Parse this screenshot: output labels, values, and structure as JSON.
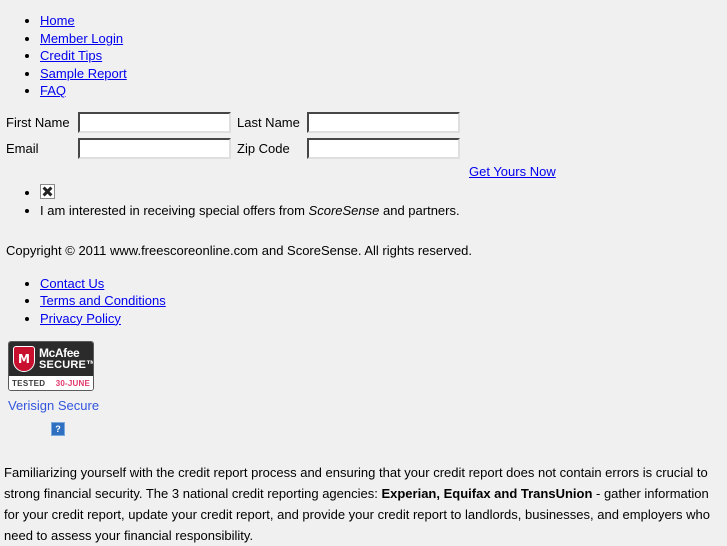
{
  "colors": {
    "page_background": "#f0f0f0",
    "link": "#0000ee",
    "verisign_link": "#3355dd",
    "mcafee_dark": "#2b2b2b",
    "mcafee_shield_red": "#c8102e",
    "mcafee_date_red": "#e0386a"
  },
  "top_nav": {
    "items": [
      {
        "label": "Home"
      },
      {
        "label": "Member Login"
      },
      {
        "label": "Credit Tips"
      },
      {
        "label": "Sample Report"
      },
      {
        "label": "FAQ"
      }
    ]
  },
  "signup_form": {
    "fields": [
      {
        "label": "First Name",
        "value": "",
        "placeholder": ""
      },
      {
        "label": "Last Name",
        "value": "",
        "placeholder": ""
      },
      {
        "label": "Email",
        "value": "",
        "placeholder": ""
      },
      {
        "label": "Zip Code",
        "value": "",
        "placeholder": ""
      }
    ],
    "submit_label": "Get Yours Now"
  },
  "offers": {
    "broken_image_alt": "broken-image",
    "consent_text_before": "I am interested in receiving special offers from ",
    "brand": "ScoreSense",
    "consent_text_after": " and partners."
  },
  "copyright": {
    "text": "Copyright © 2011 www.freescoreonline.com and ScoreSense. All rights reserved."
  },
  "footer_nav": {
    "items": [
      {
        "label": "Contact Us"
      },
      {
        "label": "Terms and Conditions"
      },
      {
        "label": "Privacy Policy"
      }
    ]
  },
  "seals": {
    "mcafee": {
      "shield_letter": "M",
      "brand_line1": "McAfee",
      "brand_line2": "SECURE™",
      "tested_label": "TESTED",
      "tested_date": "30-JUNE"
    },
    "verisign": {
      "label": "Verisign Secure",
      "placeholder_glyph": "?"
    }
  },
  "bottom_paragraph": {
    "part1": "Familiarizing yourself with the credit report process and ensuring that your credit report does not contain errors is crucial to strong financial security. The 3 national credit reporting agencies: ",
    "bold": "Experian, Equifax and TransUnion",
    "part2": " - gather information for your credit report, update your credit report, and provide your credit report to landlords, businesses, and employers who need to assess your financial responsibility."
  }
}
